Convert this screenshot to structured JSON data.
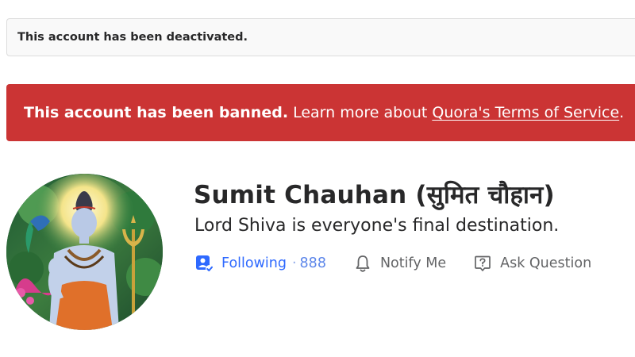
{
  "notices": {
    "deactivated": "This account has been deactivated.",
    "banned_strong": "This account has been banned.",
    "banned_text": " Learn more about ",
    "banned_link": "Quora's Terms of Service",
    "banned_end": "."
  },
  "profile": {
    "name": "Sumit Chauhan (सुमित चौहान)",
    "bio": "Lord Shiva is everyone's final destination.",
    "avatar_icon": "shiva-avatar"
  },
  "actions": {
    "following_label": "Following",
    "following_sep": "·",
    "following_count": "888",
    "notify_label": "Notify Me",
    "ask_label": "Ask Question"
  },
  "colors": {
    "banned_bg": "#cb3434",
    "accent_blue": "#2e69ff",
    "muted_text": "#636466"
  }
}
